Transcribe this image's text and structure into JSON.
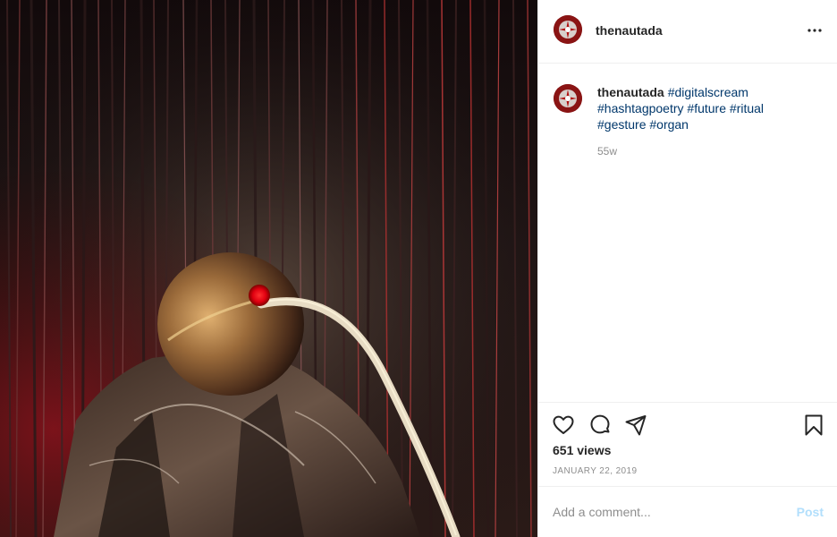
{
  "post": {
    "username": "thenautada",
    "caption_user": "thenautada",
    "hashtags": [
      "#digitalscream",
      "#hashtagpoetry",
      "#future",
      "#ritual",
      "#gesture",
      "#organ"
    ],
    "caption_time": "55w",
    "views": "651 views",
    "date": "JANUARY 22, 2019"
  },
  "comment_box": {
    "placeholder": "Add a comment...",
    "post_label": "Post"
  },
  "icons": {
    "more": "more-options-icon",
    "like": "heart-icon",
    "comment": "comment-bubble-icon",
    "share": "paper-plane-icon",
    "save": "bookmark-icon"
  },
  "colors": {
    "hashtag": "#00376b",
    "post_button_disabled": "#b2dffc",
    "muted_text": "#8e8e8e",
    "divider": "#efefef"
  }
}
